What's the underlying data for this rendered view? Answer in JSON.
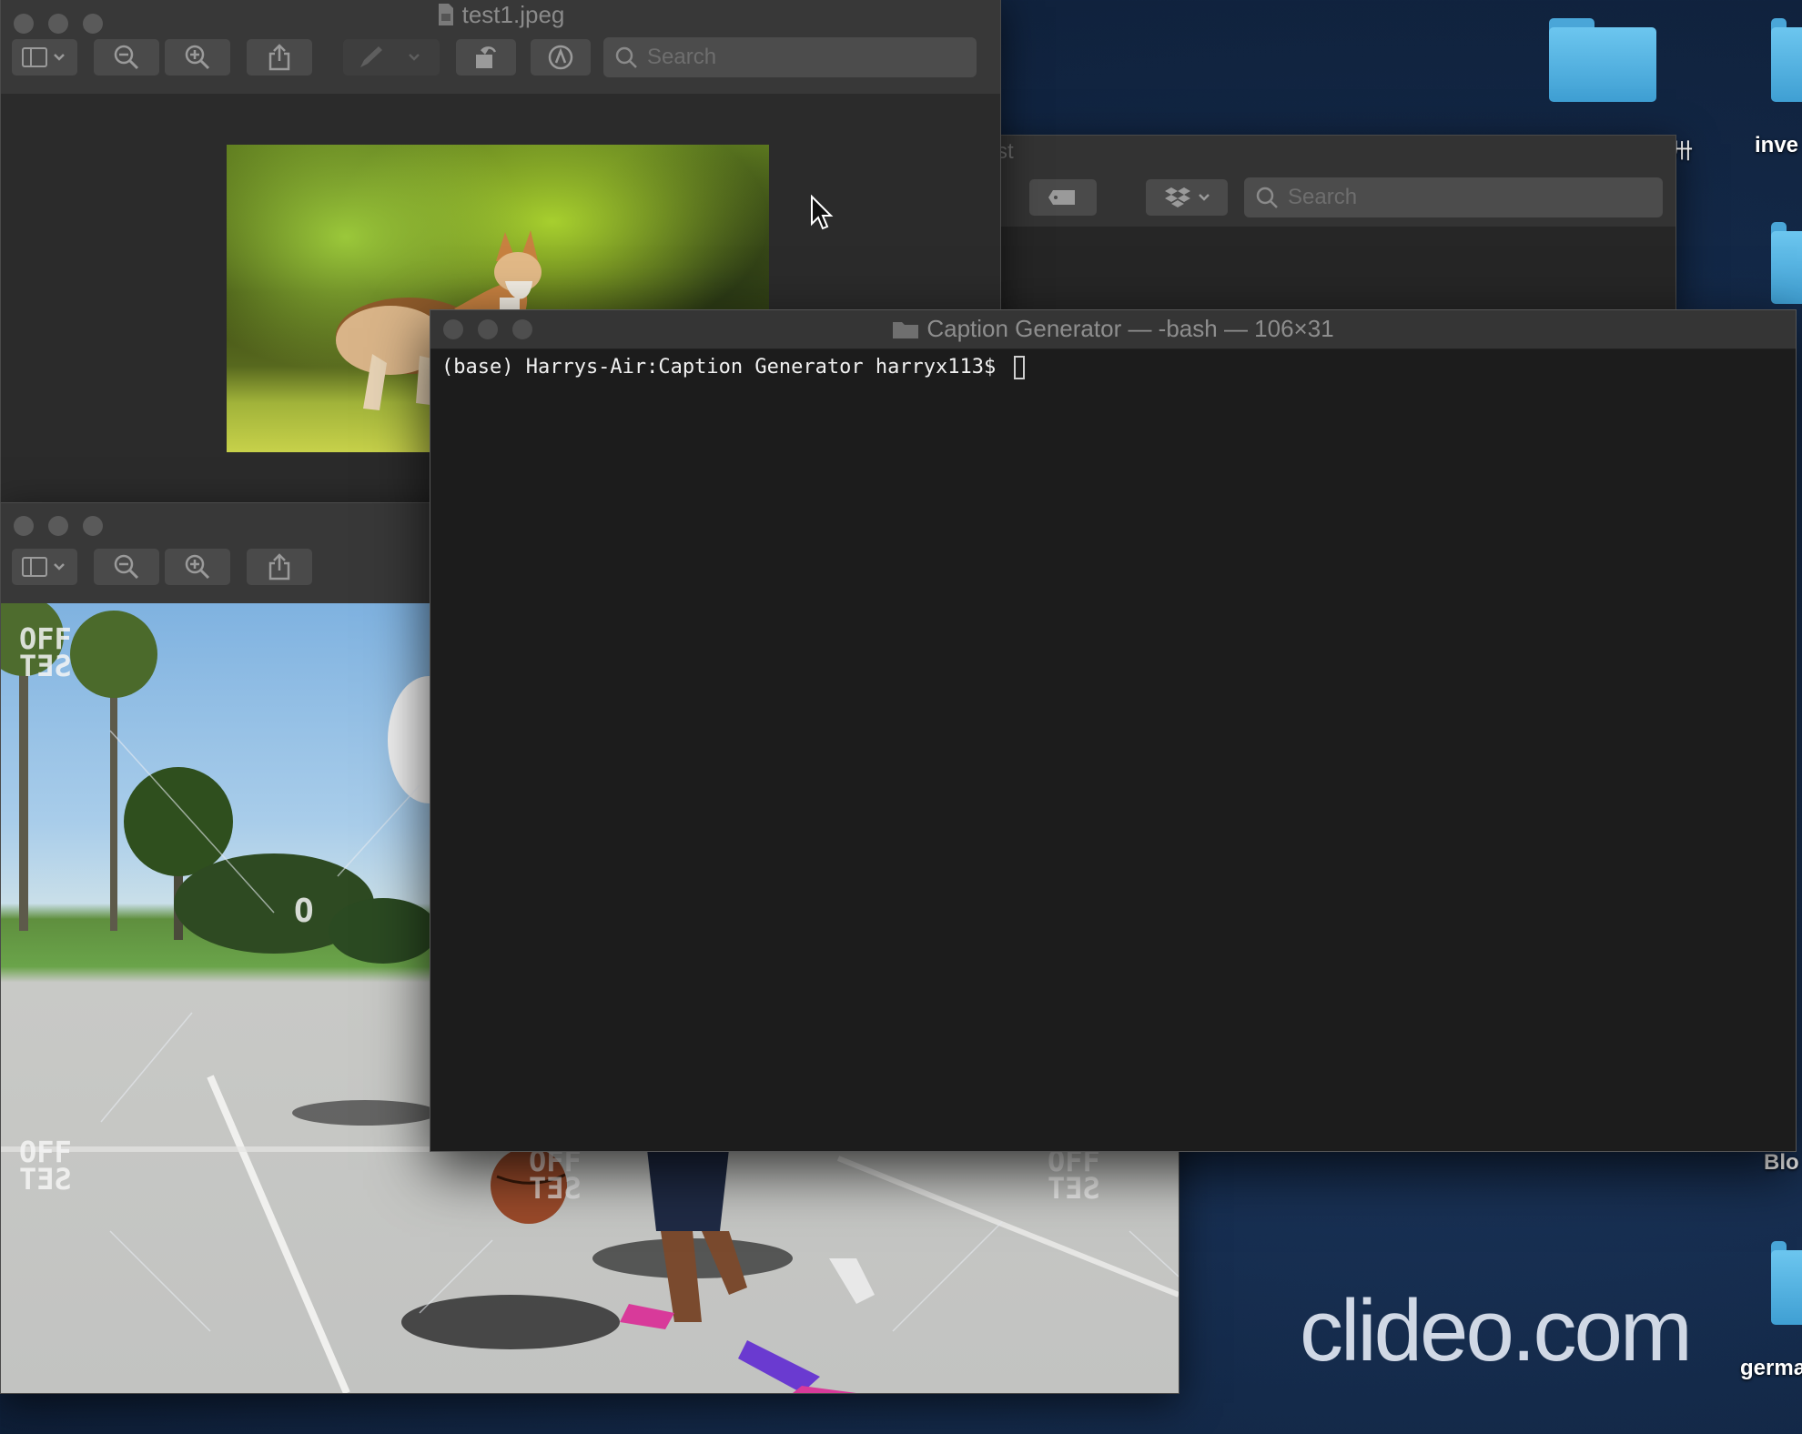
{
  "desktop": {
    "labels": {
      "invest": "inve",
      "glyph": "卅",
      "blo": "Blo",
      "germ": "germa"
    },
    "watermark": "clideo.com"
  },
  "preview_top": {
    "title": "test1.jpeg",
    "search_placeholder": "Search"
  },
  "finder_behind": {
    "title_fragment": "st",
    "search_placeholder": "Search"
  },
  "preview_bottom": {
    "photo_watermarks": [
      "OFF",
      "SET",
      "OFF",
      "SET",
      "OFF",
      "SET",
      "OFF",
      "SET",
      "O"
    ]
  },
  "terminal": {
    "title": "Caption Generator — -bash — 106×31",
    "prompt": "(base) Harrys-Air:Caption Generator harryx113$ "
  },
  "colors": {
    "desktop_bg": "#142a4a",
    "folder": "#5fbbe8",
    "window_chrome": "#383838",
    "terminal_bg": "#1c1c1c"
  },
  "icons": [
    "sidebar-icon",
    "zoom-out-icon",
    "zoom-in-icon",
    "share-icon",
    "markup-pen-icon",
    "rotate-icon",
    "annotate-icon",
    "search-icon",
    "tag-icon",
    "dropbox-icon",
    "folder-icon",
    "mouse-pointer-icon"
  ]
}
